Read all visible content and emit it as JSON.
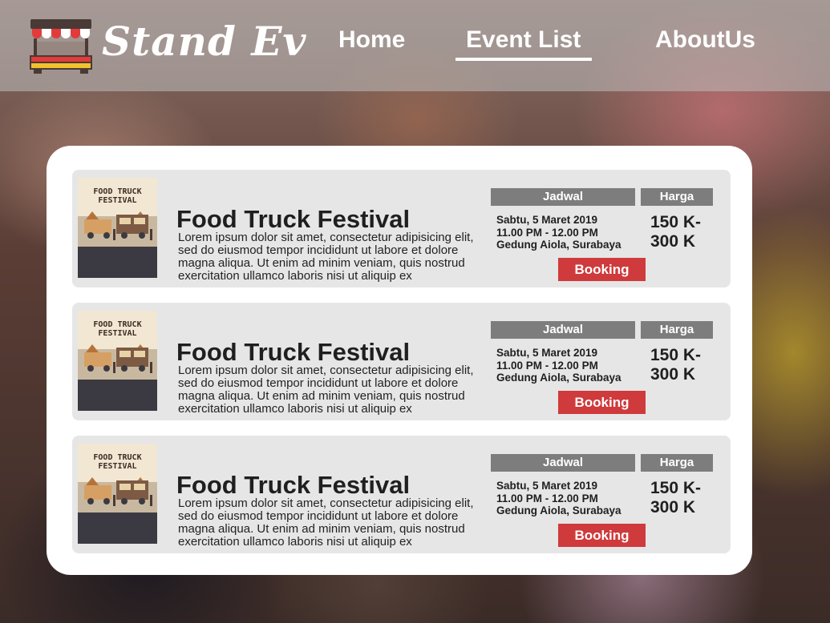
{
  "brand": {
    "name": "Stand Ev",
    "icon": "market-stall-icon"
  },
  "nav": {
    "home": "Home",
    "events": "Event List",
    "about": "AboutUs",
    "active": "Event List"
  },
  "colors": {
    "accent_red": "#cf3a3c",
    "header_gray": "#7d7d7d",
    "card_bg": "#e6e6e6"
  },
  "events": [
    {
      "poster": {
        "title": "FOOD TRUCK FESTIVAL"
      },
      "title": "Food Truck Festival",
      "description": "Lorem ipsum dolor sit amet, consectetur adipisicing elit, sed do eiusmod tempor incididunt ut labore et dolore magna aliqua. Ut enim ad minim veniam, quis nostrud exercitation ullamco laboris nisi ut aliquip ex",
      "jadwal_label": "Jadwal",
      "harga_label": "Harga",
      "date": "Sabtu, 5 Maret 2019",
      "time": "11.00 PM - 12.00 PM",
      "venue": "Gedung Aiola, Surabaya",
      "price_low": "150 K-",
      "price_high": "300 K",
      "booking_label": "Booking"
    },
    {
      "poster": {
        "title": "FOOD TRUCK FESTIVAL"
      },
      "title": "Food Truck Festival",
      "description": "Lorem ipsum dolor sit amet, consectetur adipisicing elit, sed do eiusmod tempor incididunt ut labore et dolore magna aliqua. Ut enim ad minim veniam, quis nostrud exercitation ullamco laboris nisi ut aliquip ex",
      "jadwal_label": "Jadwal",
      "harga_label": "Harga",
      "date": "Sabtu, 5 Maret 2019",
      "time": "11.00 PM - 12.00 PM",
      "venue": "Gedung Aiola, Surabaya",
      "price_low": "150 K-",
      "price_high": "300 K",
      "booking_label": "Booking"
    },
    {
      "poster": {
        "title": "FOOD TRUCK FESTIVAL"
      },
      "title": "Food Truck Festival",
      "description": "Lorem ipsum dolor sit amet, consectetur adipisicing elit, sed do eiusmod tempor incididunt ut labore et dolore magna aliqua. Ut enim ad minim veniam, quis nostrud exercitation ullamco laboris nisi ut aliquip ex",
      "jadwal_label": "Jadwal",
      "harga_label": "Harga",
      "date": "Sabtu, 5 Maret 2019",
      "time": "11.00 PM - 12.00 PM",
      "venue": "Gedung Aiola, Surabaya",
      "price_low": "150 K-",
      "price_high": "300 K",
      "booking_label": "Booking"
    }
  ]
}
